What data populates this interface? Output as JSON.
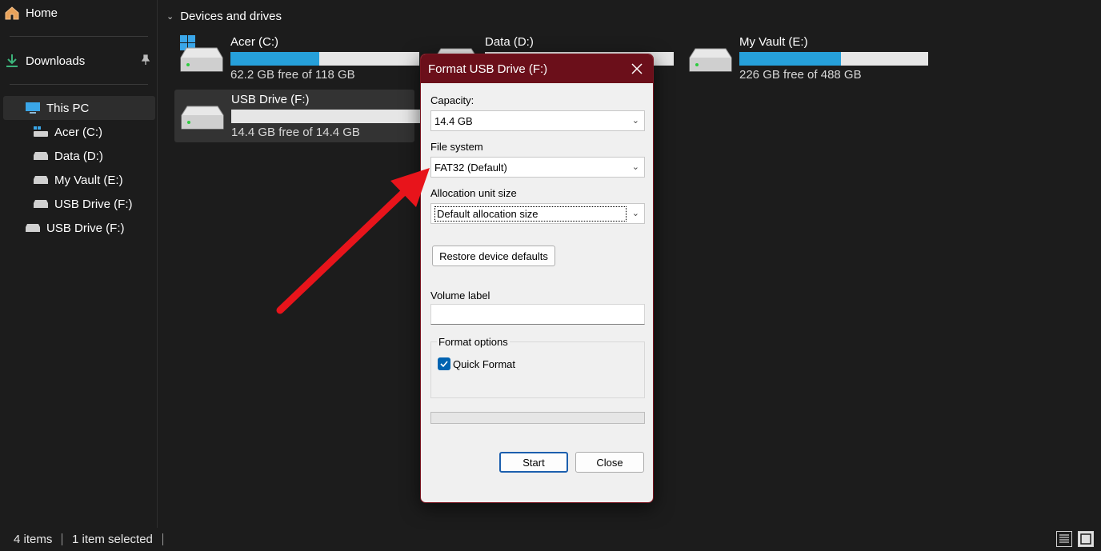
{
  "sidebar": {
    "home": "Home",
    "downloads": "Downloads",
    "this_pc": "This PC",
    "children": [
      "Acer (C:)",
      "Data (D:)",
      "My Vault (E:)",
      "USB Drive (F:)"
    ],
    "usb_root": "USB Drive (F:)"
  },
  "main": {
    "section_title": "Devices and drives",
    "drives": [
      {
        "name": "Acer (C:)",
        "free": "62.2 GB free of 118 GB",
        "used_fraction": 0.47
      },
      {
        "name": "Data (D:)",
        "free": "",
        "used_fraction": 0.0
      },
      {
        "name": "My Vault (E:)",
        "free": "226 GB free of 488 GB",
        "used_fraction": 0.54
      },
      {
        "name": "USB Drive (F:)",
        "free": "14.4 GB free of 14.4 GB",
        "used_fraction": 0.0
      }
    ]
  },
  "statusbar": {
    "items": "4 items",
    "selected": "1 item selected"
  },
  "dialog": {
    "title": "Format USB Drive (F:)",
    "close_icon": "close-icon",
    "capacity_label": "Capacity:",
    "capacity_value": "14.4 GB",
    "filesystem_label": "File system",
    "filesystem_value": "FAT32 (Default)",
    "alloc_label": "Allocation unit size",
    "alloc_value": "Default allocation size",
    "restore_label": "Restore device defaults",
    "volume_label": "Volume label",
    "volume_value": "",
    "format_options_label": "Format options",
    "quick_format_label": "Quick Format",
    "quick_format_checked": true,
    "start_label": "Start",
    "close_label": "Close"
  },
  "colors": {
    "title_bar": "#6b0f1a",
    "usage_fill": "#26a0da",
    "annotation_arrow": "#e8141b"
  }
}
